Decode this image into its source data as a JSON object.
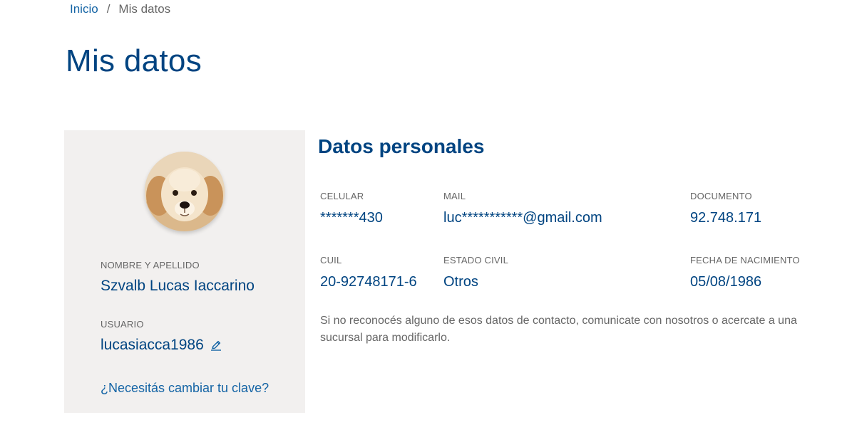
{
  "breadcrumb": {
    "home": "Inicio",
    "separator": "/",
    "current": "Mis datos"
  },
  "page": {
    "title": "Mis datos"
  },
  "profile": {
    "name_label": "NOMBRE Y APELLIDO",
    "name": "Szvalb Lucas Iaccarino",
    "user_label": "USUARIO",
    "user": "lucasiacca1986",
    "change_password": "¿Necesitás cambiar tu clave?",
    "avatar_icon": "puppy-avatar",
    "edit_icon": "pencil-icon"
  },
  "personal": {
    "title": "Datos personales",
    "fields": [
      {
        "label": "CELULAR",
        "value": "*******430"
      },
      {
        "label": "MAIL",
        "value": "luc***********@gmail.com"
      },
      {
        "label": "DOCUMENTO",
        "value": "92.748.171"
      },
      {
        "label": "CUIL",
        "value": "20-92748171-6"
      },
      {
        "label": "ESTADO CIVIL",
        "value": "Otros"
      },
      {
        "label": "FECHA DE NACIMIENTO",
        "value": "05/08/1986"
      }
    ],
    "note": "Si no reconocés alguno de esos datos de contacto, comunicate con nosotros o acercate a una sucursal para modificarlo."
  },
  "colors": {
    "primary": "#004481",
    "link": "#1464a5",
    "muted": "#666666",
    "card_bg": "#f2f0ef"
  }
}
